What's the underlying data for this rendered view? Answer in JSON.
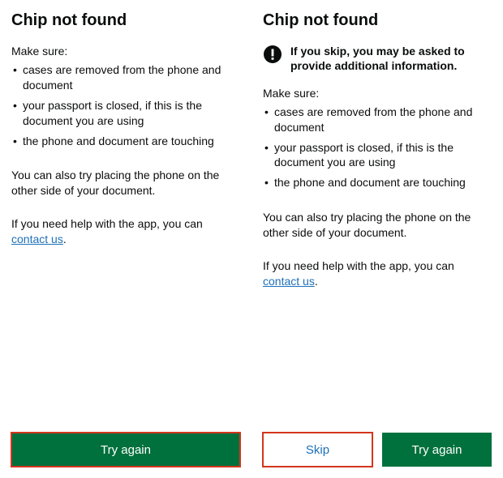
{
  "left": {
    "heading": "Chip not found",
    "makeSureLead": "Make sure:",
    "bullets": [
      "cases are removed from the phone and document",
      "your passport is closed, if this is the document you are using",
      "the phone and document are touching"
    ],
    "altPlacement": "You can also try placing the phone on the other side of your document.",
    "helpPrefix": "If you need help with the app, you can ",
    "helpLink": "contact us",
    "helpSuffix": ".",
    "tryAgain": "Try again"
  },
  "right": {
    "heading": "Chip not found",
    "noticeText": "If you skip, you may be asked to provide additional information.",
    "makeSureLead": "Make sure:",
    "bullets": [
      "cases are removed from the phone and document",
      "your passport is closed, if this is the document you are using",
      "the phone and document are touching"
    ],
    "altPlacement": "You can also try placing the phone on the other side of your document.",
    "helpPrefix": "If you need help with the app, you can ",
    "helpLink": "contact us",
    "helpSuffix": ".",
    "skip": "Skip",
    "tryAgain": "Try again"
  }
}
